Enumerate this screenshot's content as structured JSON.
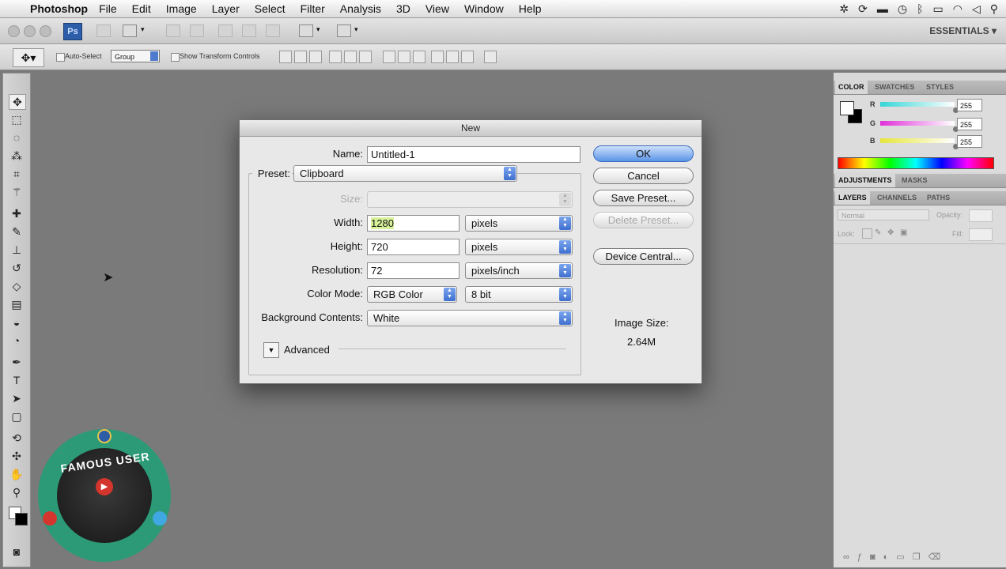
{
  "menubar": {
    "apple": "",
    "app_name": "Photoshop",
    "items": [
      "File",
      "Edit",
      "Image",
      "Layer",
      "Select",
      "Filter",
      "Analysis",
      "3D",
      "View",
      "Window",
      "Help"
    ]
  },
  "appbar": {
    "ps_badge": "Ps",
    "workspace": "ESSENTIALS ▾"
  },
  "options": {
    "auto_select_label": "Auto-Select",
    "auto_select_value": "Group",
    "show_transform_label": "Show Transform Controls"
  },
  "panels": {
    "color_tabs": [
      "COLOR",
      "SWATCHES",
      "STYLES"
    ],
    "channels": [
      {
        "label": "R",
        "value": "255",
        "color": "#36d6d6"
      },
      {
        "label": "G",
        "value": "255",
        "color": "#e030d8"
      },
      {
        "label": "B",
        "value": "255",
        "color": "#e6e63a"
      }
    ],
    "adjust_tabs": [
      "ADJUSTMENTS",
      "MASKS"
    ],
    "layers_tabs": [
      "LAYERS",
      "CHANNELS",
      "PATHS"
    ],
    "blend_mode": "Normal",
    "opacity_label": "Opacity:",
    "lock_label": "Lock:",
    "fill_label": "Fill:"
  },
  "dialog": {
    "title": "New",
    "name_label": "Name:",
    "name_value": "Untitled-1",
    "preset_label": "Preset:",
    "preset_value": "Clipboard",
    "size_label": "Size:",
    "size_value": "",
    "width_label": "Width:",
    "width_value": "1280",
    "width_unit": "pixels",
    "height_label": "Height:",
    "height_value": "720",
    "height_unit": "pixels",
    "resolution_label": "Resolution:",
    "resolution_value": "72",
    "resolution_unit": "pixels/inch",
    "color_mode_label": "Color Mode:",
    "color_mode_value": "RGB Color",
    "bit_depth_value": "8 bit",
    "background_label": "Background Contents:",
    "background_value": "White",
    "advanced_label": "Advanced",
    "ok_label": "OK",
    "cancel_label": "Cancel",
    "save_preset_label": "Save Preset...",
    "delete_preset_label": "Delete Preset...",
    "device_central_label": "Device Central...",
    "image_size_label": "Image Size:",
    "image_size_value": "2.64M"
  },
  "watermark": {
    "text": "FAMOUS USER"
  }
}
